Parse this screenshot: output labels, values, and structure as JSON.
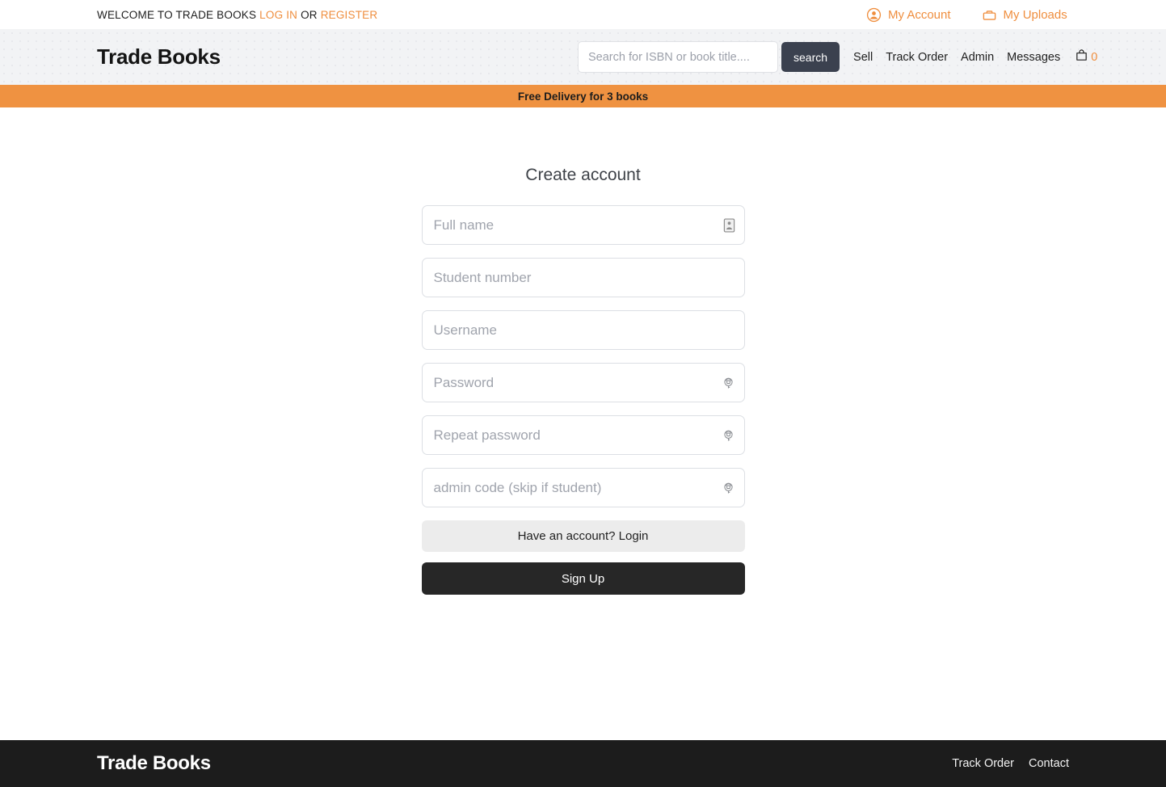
{
  "topbar": {
    "welcome_text": "WELCOME TO TRADE BOOKS",
    "login_label": "LOG IN",
    "or_label": "OR",
    "register_label": "REGISTER",
    "account_label": "My Account",
    "account_icon": "user-circle-icon",
    "uploads_label": "My Uploads",
    "uploads_icon": "briefcase-icon"
  },
  "header": {
    "logo": "Trade Books",
    "search_placeholder": "Search for ISBN or book title....",
    "search_value": "",
    "search_button": "search",
    "nav": [
      {
        "label": "Sell"
      },
      {
        "label": "Track Order"
      },
      {
        "label": "Admin"
      },
      {
        "label": "Messages"
      }
    ],
    "cart_icon": "shopping-bag-icon",
    "cart_count": "0"
  },
  "banner": {
    "text": "Free Delivery for 3 books"
  },
  "form": {
    "title": "Create account",
    "fields": [
      {
        "name": "full-name",
        "placeholder": "Full name",
        "value": "",
        "type": "text",
        "icon": "contact-card-icon"
      },
      {
        "name": "student-number",
        "placeholder": "Student number",
        "value": "",
        "type": "text",
        "icon": ""
      },
      {
        "name": "username",
        "placeholder": "Username",
        "value": "",
        "type": "text",
        "icon": ""
      },
      {
        "name": "password",
        "placeholder": "Password",
        "value": "",
        "type": "password",
        "icon": "key-lock-icon"
      },
      {
        "name": "repeat-password",
        "placeholder": "Repeat password",
        "value": "",
        "type": "password",
        "icon": "key-lock-icon"
      },
      {
        "name": "admin-code",
        "placeholder": "admin code (skip if student)",
        "value": "",
        "type": "password",
        "icon": "key-lock-icon"
      }
    ],
    "login_button": "Have an account? Login",
    "signup_button": "Sign Up"
  },
  "footer": {
    "logo": "Trade Books",
    "links": [
      {
        "label": "Track Order"
      },
      {
        "label": "Contact"
      }
    ]
  },
  "colors": {
    "accent_orange": "#ef8e3e",
    "banner_orange": "#ef9241",
    "dark": "#272727",
    "search_btn": "#3b414f",
    "header_bg": "#f2f3f5"
  }
}
